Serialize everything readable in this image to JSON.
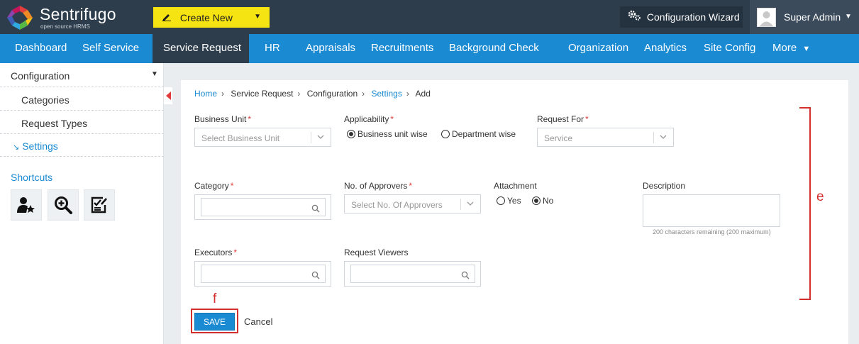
{
  "app": {
    "brand": "Sentrifugo",
    "tagline": "open source HRMS",
    "create_new_label": "Create New",
    "config_wizard_label": "Configuration Wizard",
    "user_name": "Super Admin"
  },
  "nav": {
    "items": [
      "Dashboard",
      "Self Service",
      "Service Request",
      "HR",
      "Appraisals",
      "Recruitments",
      "Background Check",
      "Organization",
      "Analytics",
      "Site Config",
      "More"
    ],
    "active": "Service Request"
  },
  "sidebar": {
    "section": "Configuration",
    "items": [
      {
        "label": "Categories"
      },
      {
        "label": "Request Types"
      },
      {
        "label": "Settings"
      }
    ],
    "current": "Settings",
    "shortcuts_title": "Shortcuts",
    "shortcut_icons": [
      "user-star-icon",
      "zoom-in-icon",
      "checklist-icon"
    ]
  },
  "breadcrumb": [
    "Home",
    "Service Request",
    "Configuration",
    "Settings",
    "Add"
  ],
  "form": {
    "business_unit": {
      "label": "Business Unit",
      "placeholder": "Select Business Unit"
    },
    "applicability": {
      "label": "Applicability",
      "options": [
        "Business unit wise",
        "Department wise"
      ],
      "selected": "Business unit wise"
    },
    "request_for": {
      "label": "Request For",
      "value": "Service"
    },
    "category": {
      "label": "Category",
      "value": ""
    },
    "approvers": {
      "label": "No. of Approvers",
      "placeholder": "Select No. Of Approvers"
    },
    "attachment": {
      "label": "Attachment",
      "options": [
        "Yes",
        "No"
      ],
      "selected": "No"
    },
    "description": {
      "label": "Description",
      "value": "",
      "char_count": "200 characters remaining (200 maximum)"
    },
    "executors": {
      "label": "Executors",
      "value": ""
    },
    "request_viewers": {
      "label": "Request Viewers",
      "value": ""
    },
    "required_mark": "*",
    "save_label": "SAVE",
    "cancel_label": "Cancel"
  },
  "annotations": {
    "e": "e",
    "f": "f"
  },
  "colors": {
    "topbar": "#2e3d4c",
    "nav": "#1a8ad2",
    "accent": "#1a8ad2",
    "create_new": "#f5e312",
    "annotation": "#d32f2f"
  }
}
